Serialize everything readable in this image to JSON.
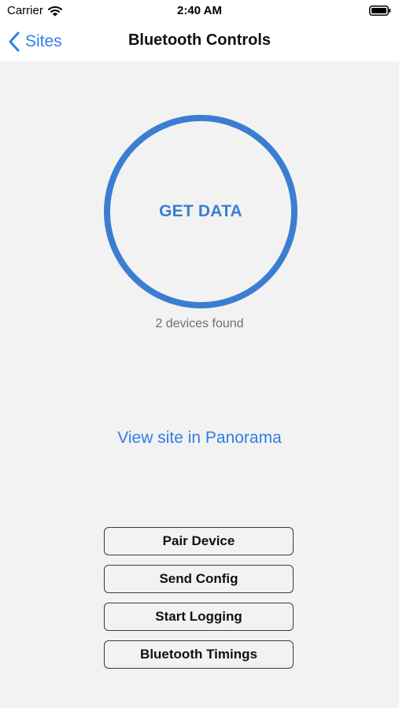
{
  "status_bar": {
    "carrier": "Carrier",
    "time": "2:40 AM",
    "wifi_icon": "wifi-icon",
    "battery_icon": "battery-icon"
  },
  "navigation": {
    "back_label": "Sites",
    "title": "Bluetooth Controls",
    "back_icon": "chevron-left-icon"
  },
  "main": {
    "primary_button_label": "GET DATA",
    "devices_found_text": "2 devices found",
    "panorama_link_text": "View site in Panorama",
    "actions": [
      {
        "label": "Pair Device"
      },
      {
        "label": "Send Config"
      },
      {
        "label": "Start Logging"
      },
      {
        "label": "Bluetooth Timings"
      }
    ]
  },
  "colors": {
    "background": "#f2f2f2",
    "header_background": "#ffffff",
    "accent_blue": "#2f7fe6",
    "circle_blue": "#3a7ed1",
    "secondary_text": "#6f6f6f",
    "border_dark": "#3c3c3c"
  }
}
